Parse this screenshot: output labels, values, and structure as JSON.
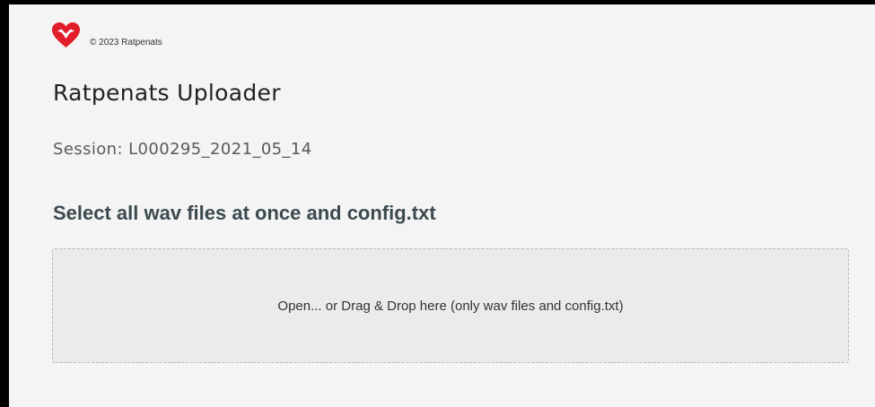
{
  "header": {
    "logo_icon": "heart-logo-icon",
    "copyright": "© 2023 Ratpenats"
  },
  "main": {
    "title": "Ratpenats Uploader",
    "session_label": "Session:",
    "session_id": "L000295_2021_05_14",
    "instruction": "Select all wav files at once and config.txt",
    "dropzone_text": "Open... or Drag & Drop here (only wav files and config.txt)"
  },
  "colors": {
    "brand": "#e11d2a",
    "background": "#f4f4f4",
    "dropzone_bg": "#ebebeb",
    "instruction_text": "#3c4a50"
  }
}
